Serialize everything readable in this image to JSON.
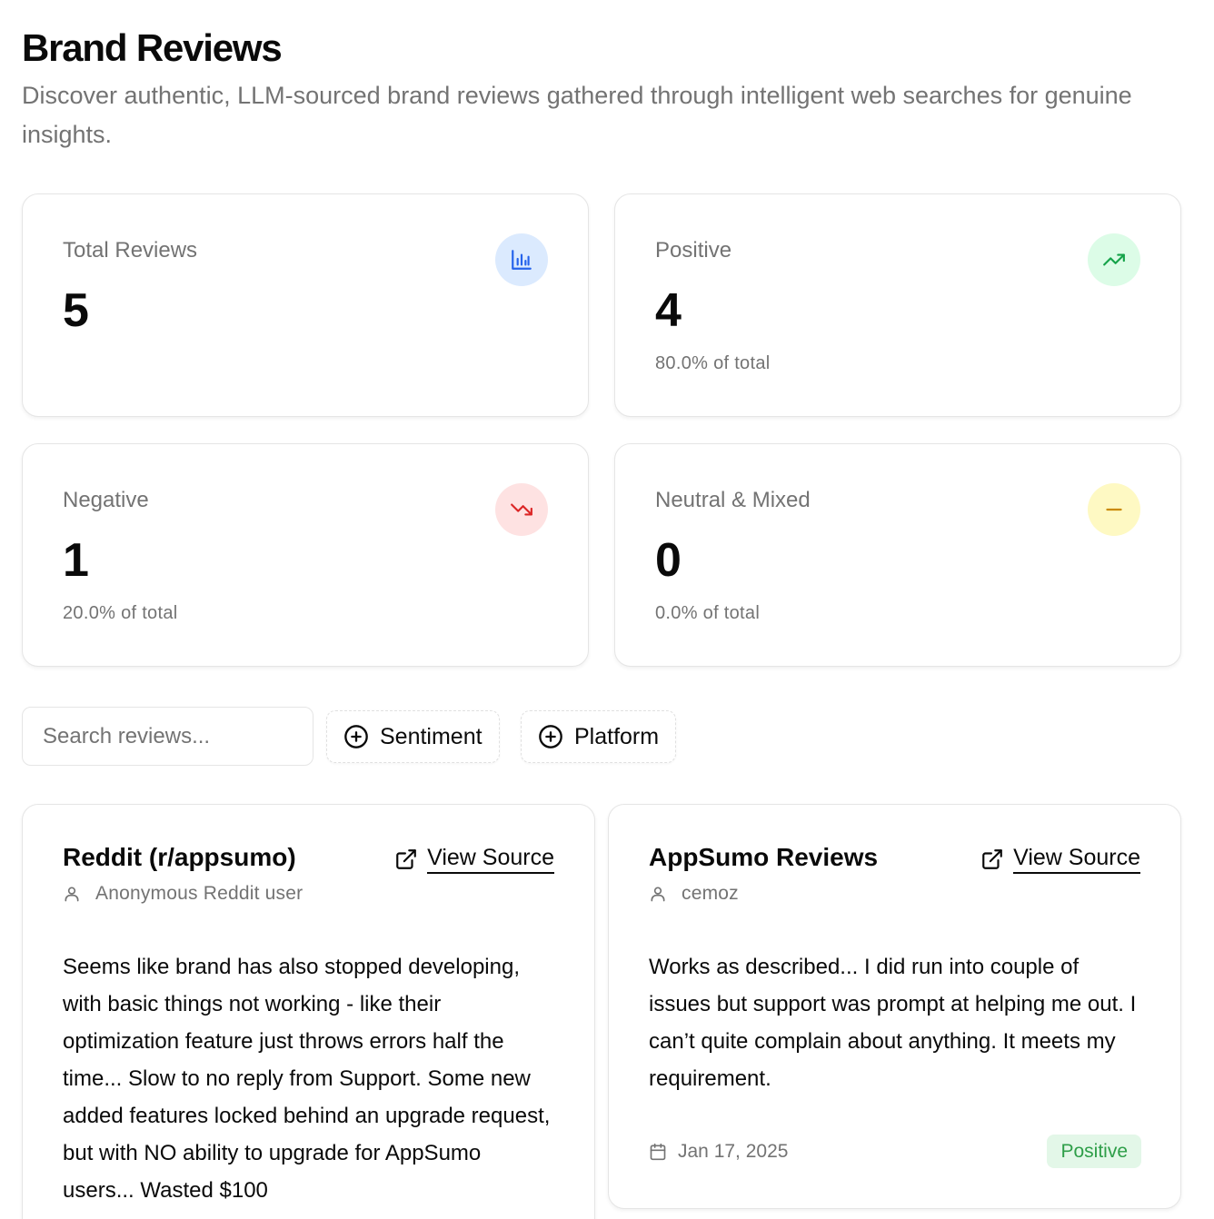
{
  "header": {
    "title": "Brand Reviews",
    "subtitle": "Discover authentic, LLM-sourced brand reviews gathered through intelligent web searches for genuine insights."
  },
  "stats": [
    {
      "label": "Total Reviews",
      "value": "5",
      "sub": "",
      "icon": "bar-chart-icon",
      "icon_bg": "#dbeafe",
      "icon_color": "#2563eb"
    },
    {
      "label": "Positive",
      "value": "4",
      "sub": "80.0% of total",
      "icon": "trending-up-icon",
      "icon_bg": "#dcfce7",
      "icon_color": "#16a34a"
    },
    {
      "label": "Negative",
      "value": "1",
      "sub": "20.0% of total",
      "icon": "trending-down-icon",
      "icon_bg": "#fee2e2",
      "icon_color": "#dc2626"
    },
    {
      "label": "Neutral & Mixed",
      "value": "0",
      "sub": "0.0% of total",
      "icon": "minus-icon",
      "icon_bg": "#fef9c3",
      "icon_color": "#ca8a04"
    }
  ],
  "filters": {
    "search_placeholder": "Search reviews...",
    "sentiment_label": "Sentiment",
    "platform_label": "Platform"
  },
  "reviews": [
    {
      "platform": "Reddit (r/appsumo)",
      "view_source": "View Source",
      "author": "Anonymous Reddit user",
      "body": "Seems like brand has also stopped developing, with basic things not working - like their optimization feature just throws errors half the time... Slow to no reply from Support. Some new added features locked behind an upgrade request, but with NO ability to upgrade for AppSumo users... Wasted $100",
      "date": "",
      "sentiment": ""
    },
    {
      "platform": "AppSumo Reviews",
      "view_source": "View Source",
      "author": "cemoz",
      "body": "Works as described... I did run into couple of issues but support was prompt at helping me out. I can’t quite complain about anything. It meets my requirement.",
      "date": "Jan 17, 2025",
      "sentiment": "Positive"
    }
  ],
  "colors": {
    "muted_text": "#737373",
    "positive_badge_bg": "#e3f7e8",
    "positive_badge_text": "#2e9e48"
  }
}
